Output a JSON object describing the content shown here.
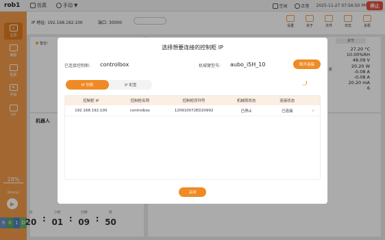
{
  "app": {
    "name": "rob1"
  },
  "topbar": {
    "items": [
      "仿真",
      "手动"
    ],
    "status": [
      "空闲",
      "正常"
    ],
    "datetime": "2025-11-27 07:56:50 PM",
    "stop_label": "停止"
  },
  "sidebar": {
    "items": [
      "主页",
      "编程",
      "配置",
      "手动",
      "I/O"
    ],
    "speed_percent": "28%",
    "speed_unit": "0mm/s",
    "io_strip": [
      "9",
      "0",
      "1",
      "D"
    ]
  },
  "ipbar": {
    "ip_text": "IP 地址: 192.168.192.100",
    "port_text": "端口: 30000",
    "tools": [
      "设置",
      "关于",
      "文件",
      "日志",
      "关机"
    ]
  },
  "background": {
    "warning_text": "警告!",
    "robot_title": "机器人",
    "right_header": "关节",
    "right_side_label": "距",
    "right_values": [
      "27.20 °C",
      "10.00%RH",
      "48.09 V",
      "20.20 W",
      "-0.08 A",
      "-0.08 A",
      "20.20 mA",
      "6"
    ],
    "time_labels": [
      "日",
      "小时",
      "分钟",
      "秒"
    ],
    "time_values": [
      "20",
      "01",
      "09",
      "50"
    ]
  },
  "modal": {
    "title": "选择想要连接的控制柜 IP",
    "connected_label": "已连接控制柜:",
    "connected_value": "controlbox",
    "arm_label": "机械臂型号:",
    "arm_value": "aubo_i5H_10",
    "disconnect_label": "断开连接",
    "tabs": [
      "IP 列表",
      "IP 配置"
    ],
    "table": {
      "headers": [
        "控制柜 IP",
        "控制柜名称",
        "控制柜序列号",
        "机械臂状态",
        "连接状态"
      ],
      "rows": [
        {
          "ip": "192.168.192.100",
          "name": "controlbox",
          "serial": "120910072ED20992",
          "arm_status": "已停止",
          "conn_status": "已连接"
        }
      ]
    },
    "close_label": "关闭"
  },
  "colors": {
    "accent": "#f08a24",
    "sidebar": "#f39c4a",
    "stop": "#e84d3c"
  }
}
